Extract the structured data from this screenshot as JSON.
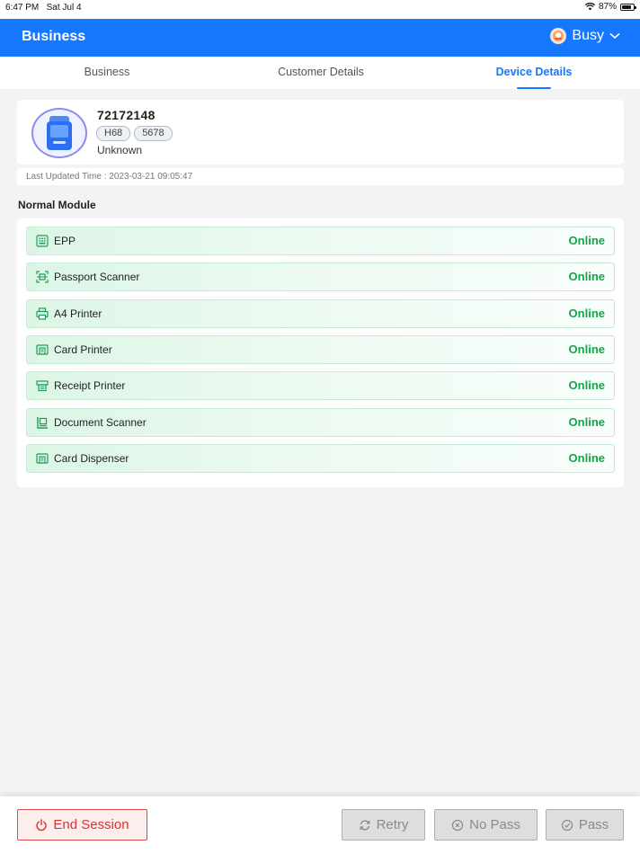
{
  "status_bar": {
    "time": "6:47 PM",
    "date": "Sat Jul 4",
    "battery": "87%"
  },
  "header": {
    "title": "Business",
    "user_status": "Busy"
  },
  "tabs": [
    {
      "label": "Business",
      "active": false
    },
    {
      "label": "Customer Details",
      "active": false
    },
    {
      "label": "Device Details",
      "active": true
    }
  ],
  "device": {
    "id": "72172148",
    "tags": [
      "H68",
      "5678"
    ],
    "status": "Unknown",
    "last_updated": "Last Updated Time : 2023-03-21 09:05:47"
  },
  "normal_module": {
    "title": "Normal Module",
    "items": [
      {
        "name": "EPP",
        "status": "Online",
        "icon": "keypad-icon"
      },
      {
        "name": "Passport Scanner",
        "status": "Online",
        "icon": "scanner-frame-icon"
      },
      {
        "name": "A4 Printer",
        "status": "Online",
        "icon": "printer-icon"
      },
      {
        "name": "Card Printer",
        "status": "Online",
        "icon": "card-printer-icon"
      },
      {
        "name": "Receipt Printer",
        "status": "Online",
        "icon": "receipt-printer-icon"
      },
      {
        "name": "Document Scanner",
        "status": "Online",
        "icon": "document-scanner-icon"
      },
      {
        "name": "Card Dispenser",
        "status": "Online",
        "icon": "card-dispenser-icon"
      }
    ]
  },
  "footer": {
    "end_session": "End Session",
    "retry": "Retry",
    "no_pass": "No Pass",
    "pass": "Pass"
  },
  "colors": {
    "primary": "#1677ff",
    "online": "#17a34a",
    "danger": "#e0302f",
    "disabled": "#8a8a8a"
  }
}
